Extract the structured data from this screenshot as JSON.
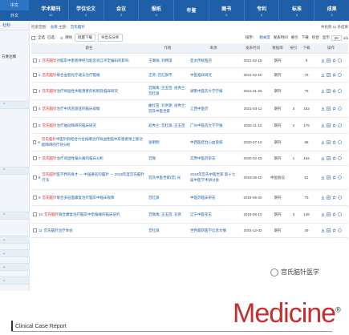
{
  "topbar": {
    "langs": [
      "中文",
      "外文"
    ],
    "tabs": [
      {
        "label": "学术期刊",
        "count": "10"
      },
      {
        "label": "学位论文",
        "count": "0"
      },
      {
        "label": "会议",
        "count": "0"
      },
      {
        "label": "报纸",
        "count": "0"
      },
      {
        "label": "年鉴",
        "count": ""
      },
      {
        "label": "图书",
        "count": "0"
      },
      {
        "label": "专利",
        "count": "0"
      },
      {
        "label": "标准",
        "count": "0"
      },
      {
        "label": "成果",
        "count": "0"
      }
    ]
  },
  "sidebar": {
    "header": "社科",
    "item": "方要注釋",
    "sections": [
      "",
      "",
      "",
      "",
      "",
      "",
      ""
    ]
  },
  "crumb": {
    "prefix": "检索范围：",
    "scope": "总库",
    "subject_label": "主题：",
    "subject": "宫氏脑针",
    "result_text": "共找到 11 条结果"
  },
  "toolbar": {
    "select_all": "全选",
    "selected": "已选：",
    "selected_count": "0",
    "clear": "清除",
    "batch_download": "批量下载",
    "export": "导出与分析",
    "sort_label": "排序：",
    "sort_relevance": "相关度",
    "sort_date": "发表时间",
    "sort_cited": "被引",
    "sort_download": "下载",
    "sort_synth": "综合",
    "page_size_label": "显示",
    "page_size": "20",
    "page_info": "1/1"
  },
  "table": {
    "headers": [
      "题名",
      "作者",
      "来源",
      "发表时间",
      "数据库",
      "被引",
      "下载",
      "操作"
    ],
    "rows": [
      {
        "n": "1",
        "hl": "宫氏脑针",
        "rest": "对脑卒中患者神经功能及语言评定编码的影响",
        "author": "王璐珠; 刘畅琪",
        "source": "亚太传统医药",
        "date": "2021-02-15",
        "db": "期刊",
        "cited": "",
        "dl": "9"
      },
      {
        "n": "2",
        "hl": "宫氏脑针",
        "rest": "联合血管化疗通法治疗脑瘫",
        "author": "王贤; 宫红旗平",
        "source": "中医临床研究",
        "date": "2021-02-10",
        "db": "期刊",
        "cited": "",
        "dl": "78"
      },
      {
        "n": "3",
        "hl": "宫氏脑针",
        "rest": "治疗顽固性失眠患者的机制及临床研究",
        "author": "宫锡禹; 王玉苗; 张秀兰; 宫红旗",
        "source": "湖南中医药大学学报",
        "date": "2021-01-25",
        "db": "期刊",
        "cited": "",
        "dl": "76"
      },
      {
        "n": "4",
        "hl": "宫氏脑针",
        "rest": "治疗中风后遗症的临床观察",
        "author": "曲红苗; 刘洪艳; 张秀兰; 宫氏中医世家",
        "source": "江西中医药",
        "date": "2021-03-11",
        "db": "期刊",
        "cited": "3",
        "dl": "182"
      },
      {
        "n": "5",
        "hl": "宫氏脑针",
        "rest": "治疗抽动障碍的临床研究",
        "author": "赵秀兰; 宫红旗; 王玉苗",
        "source": "广州中医药大学学报",
        "date": "2020-11-12",
        "db": "期刊",
        "cited": "2",
        "dl": "179"
      },
      {
        "n": "6",
        "hl": "宫氏脑针",
        "rest": "中医针刺结合穴位按摩治疗缺血性脑中卒患者颈上肢功能障碍的疗效分析",
        "author": "张明明",
        "source": "中西医结合心血管病",
        "date": "2020-07-10",
        "db": "期刊",
        "cited": "",
        "dl": "88"
      },
      {
        "n": "7",
        "hl": "宫氏脑针",
        "rest": "治疗顽固性偏头痛的临床分析",
        "author": "宫锡",
        "source": "实用中医药杂志",
        "date": "2020-02-15",
        "db": "期刊",
        "cited": "1",
        "dl": "152"
      },
      {
        "n": "8",
        "hl": "宫氏脑针",
        "rest": "医学界的奇才 — 中国著名的脑针 — 2019年度宫氏脑针疗法",
        "author": "宫氏中医世家(宫) 光",
        "source": "2019年宫氏中医世家 第十七届中医学术研讨会",
        "date": "2019-05-10",
        "db": "中国会议",
        "cited": "",
        "dl": "61"
      },
      {
        "n": "9",
        "hl": "宫氏脑针",
        "rest": "联合多层面康复治疗脑卒中临床观察",
        "author": "宫红旗",
        "source": "中医药临床杂志",
        "date": "2019-06-20",
        "db": "期刊",
        "cited": "",
        "dl": "75"
      },
      {
        "n": "10",
        "hl": "宫氏脑针",
        "rest": "联合康复治疗脑卒中后偏瘫的临床研究",
        "author": "宫锡禹; 王玉苗; 刘贤",
        "source": "辽宁中医杂志",
        "date": "2019-06-10",
        "db": "期刊",
        "cited": "3",
        "dl": "138"
      },
      {
        "n": "11",
        "hl": "",
        "rest": "宫氏脑针治疗体会",
        "author": "宫红旗",
        "source": "世界最新医学信息文摘",
        "date": "2016-12-02",
        "db": "期刊",
        "cited": "",
        "dl": "39"
      }
    ]
  },
  "brand": "宫氏脑针医学",
  "footer": {
    "journal": "Medicine",
    "reg": "®",
    "section": "Clinical Case Report"
  },
  "colors": {
    "primary": "#1f5fa8",
    "highlight": "#d62d2d",
    "brand": "#c23030"
  }
}
